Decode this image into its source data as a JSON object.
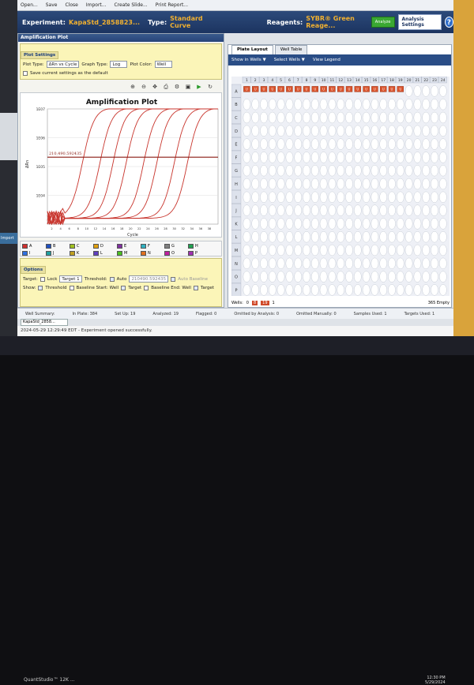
{
  "toolbar": {
    "open": "Open...",
    "save": "Save",
    "close": "Close",
    "import": "Import...",
    "create_slide": "Create Slide...",
    "print_report": "Print Report..."
  },
  "header": {
    "experiment_label": "Experiment:",
    "experiment_value": "KapaStd_2858823...",
    "type_label": "Type:",
    "type_value": "Standard Curve",
    "reagents_label": "Reagents:",
    "reagents_value": "SYBR® Green Reage...",
    "analyze_button": "Analyze",
    "analysis_settings_button": "Analysis Settings",
    "help": "?"
  },
  "left_strip": {
    "tab_label": "Import"
  },
  "amplification": {
    "pane_title": "Amplification Plot",
    "settings_tab": "Plot Settings",
    "plot_type_label": "Plot Type:",
    "plot_type_value": "ΔRn vs Cycle",
    "graph_type_label": "Graph Type:",
    "graph_type_value": "Log",
    "plot_color_label": "Plot Color:",
    "plot_color_value": "Well",
    "save_default_label": "Save current settings as the default",
    "chart_title": "Amplification Plot",
    "xlabel": "Cycle",
    "ylabel": "ΔRn",
    "threshold_label": "210,490.592435"
  },
  "chart_data": {
    "type": "line",
    "title": "Amplification Plot",
    "xlabel": "Cycle",
    "ylabel": "ΔRn",
    "yscale": "log",
    "yticks": [
      "1E07",
      "1E06",
      "1E05",
      "1E04"
    ],
    "xticks": [
      2,
      4,
      6,
      8,
      10,
      12,
      14,
      16,
      18,
      20,
      22,
      24,
      26,
      28,
      30,
      32,
      34,
      36,
      38
    ],
    "xlim": [
      1,
      40
    ],
    "ylim": [
      1000,
      10000000
    ],
    "threshold": 210490.592435,
    "series": [
      {
        "ct": 7
      },
      {
        "ct": 11
      },
      {
        "ct": 14
      },
      {
        "ct": 17
      },
      {
        "ct": 21
      },
      {
        "ct": 24
      },
      {
        "ct": 28
      },
      {
        "ct": 31
      }
    ],
    "color": "#c8342c"
  },
  "legend": [
    {
      "label": "A",
      "color": "#d03030"
    },
    {
      "label": "B",
      "color": "#2050c0"
    },
    {
      "label": "C",
      "color": "#a0c020"
    },
    {
      "label": "D",
      "color": "#e0a010"
    },
    {
      "label": "E",
      "color": "#8030a0"
    },
    {
      "label": "F",
      "color": "#30b0c0"
    },
    {
      "label": "G",
      "color": "#808080"
    },
    {
      "label": "H",
      "color": "#20a050"
    },
    {
      "label": "I",
      "color": "#3070e0"
    },
    {
      "label": "J",
      "color": "#20a0a0"
    },
    {
      "label": "K",
      "color": "#c0a020"
    },
    {
      "label": "L",
      "color": "#6040c0"
    },
    {
      "label": "M",
      "color": "#4ac020"
    },
    {
      "label": "N",
      "color": "#e07020"
    },
    {
      "label": "O",
      "color": "#c020a0"
    },
    {
      "label": "P",
      "color": "#a030b0"
    }
  ],
  "options": {
    "title": "Options",
    "target_label": "Target:",
    "lock_label": "Lock",
    "target_value": "Target 1",
    "threshold_label": "Threshold:",
    "auto_label": "Auto",
    "threshold_value": "210490.592435",
    "auto_baseline_label": "Auto Baseline",
    "show_label": "Show:",
    "threshold_show": "Threshold",
    "baseline_start_label": "Baseline Start: Well",
    "target_show": "Target",
    "baseline_end_label": "Baseline End: Well",
    "target_show2": "Target"
  },
  "plate": {
    "tab_layout": "Plate Layout",
    "tab_well_table": "Well Table",
    "show_in_wells": "Show in Wells ▼",
    "select_wells": "Select Wells ▼",
    "view_legend": "View Legend",
    "columns": [
      "1",
      "2",
      "3",
      "4",
      "5",
      "6",
      "7",
      "8",
      "9",
      "10",
      "11",
      "12",
      "13",
      "14",
      "15",
      "16",
      "17",
      "18",
      "19",
      "20",
      "21",
      "22",
      "23",
      "24"
    ],
    "rows": [
      "A",
      "B",
      "C",
      "D",
      "E",
      "F",
      "G",
      "H",
      "I",
      "J",
      "K",
      "L",
      "M",
      "N",
      "O",
      "P"
    ],
    "wells_label": "Wells:",
    "wells_counts": [
      "0",
      "8",
      "19",
      "1"
    ],
    "empty_label": "365 Empty"
  },
  "status": {
    "well_summary": "Well Summary:",
    "in_plate": "In Plate: 384",
    "set_up": "Set Up: 19",
    "analyzed": "Analyzed: 19",
    "flagged": "Flagged: 0",
    "omitted_analysis": "Omitted by Analysis: 0",
    "omitted_manually": "Omitted Manually: 0",
    "samples_used": "Samples Used: 1",
    "targets_used": "Targets Used: 1",
    "bottom_tab": "KapaStd_2858...",
    "message": "2024-05-29 12:29:49 EDT - Experiment opened successfully."
  },
  "taskbar": {
    "app": "QuantStudio™ 12K ...",
    "time": "12:30 PM",
    "date": "5/29/2024"
  }
}
